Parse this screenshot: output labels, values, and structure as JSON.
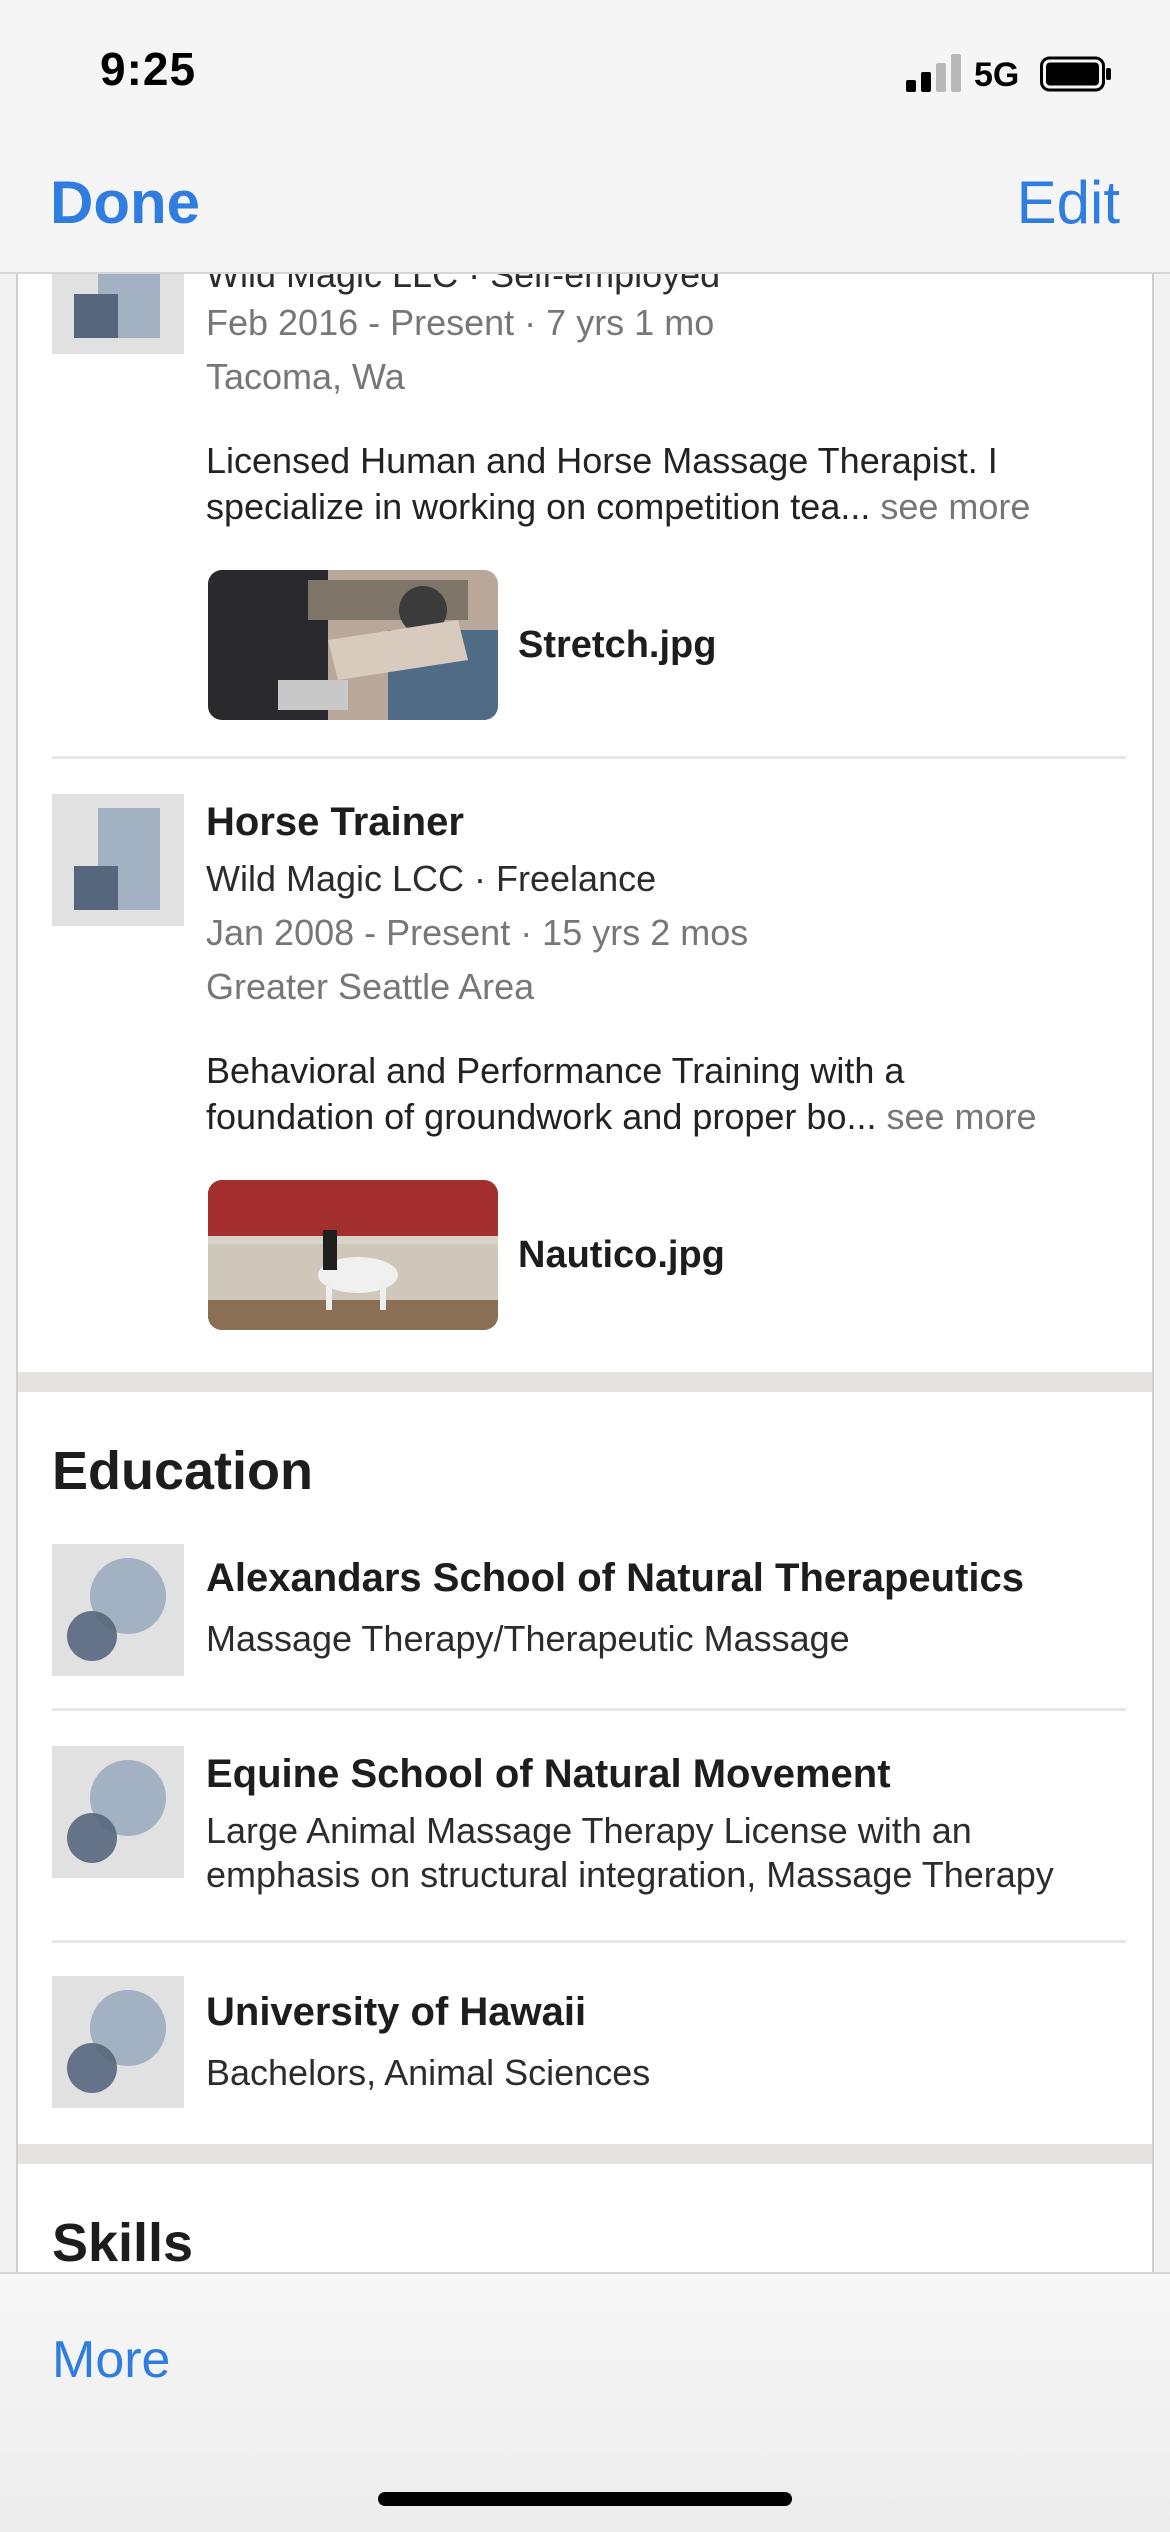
{
  "status_bar": {
    "time": "9:25",
    "network": "5G"
  },
  "nav": {
    "done_label": "Done",
    "edit_label": "Edit"
  },
  "experience": [
    {
      "company_line": "Wild Magic LLC · Self-employed",
      "dates": "Feb 2016 - Present · 7 yrs 1 mo",
      "location": "Tacoma, Wa",
      "description_line1": "Licensed Human and Horse Massage Therapist. I",
      "description_line2": "specialize in working on competition tea...",
      "see_more": "see more",
      "attachment": "Stretch.jpg"
    },
    {
      "title": "Horse Trainer",
      "company_line": "Wild Magic LCC · Freelance",
      "dates": "Jan 2008 - Present · 15 yrs 2 mos",
      "location": "Greater Seattle Area",
      "description_line1": "Behavioral and Performance Training with a",
      "description_line2": "foundation of groundwork and proper bo...",
      "see_more": "see more",
      "attachment": "Nautico.jpg"
    }
  ],
  "education": {
    "heading": "Education",
    "items": [
      {
        "school": "Alexandars School of Natural Therapeutics",
        "line1": "Massage Therapy/Therapeutic Massage"
      },
      {
        "school": "Equine School of Natural Movement",
        "line1": "Large Animal Massage Therapy License with an",
        "line2": "emphasis on structural integration, Massage Therapy"
      },
      {
        "school": "University of Hawaii",
        "line1": "Bachelors, Animal Sciences"
      }
    ]
  },
  "skills": {
    "heading": "Skills"
  },
  "toolbar": {
    "more_label": "More"
  },
  "colors": {
    "accent": "#2f7de1",
    "logo_placeholder": "#e1e1e1",
    "logo_shape": "#8ea1b8"
  }
}
